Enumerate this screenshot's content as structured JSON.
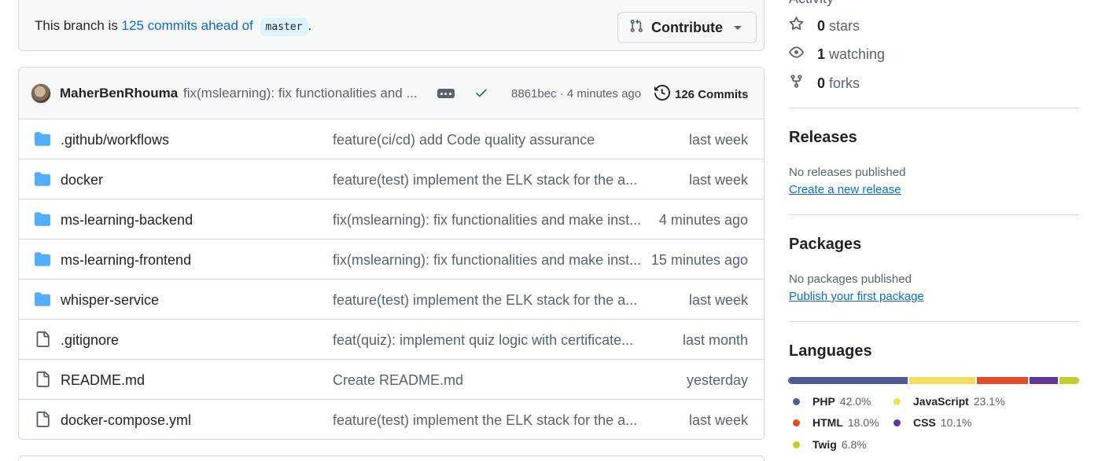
{
  "branch": {
    "prefix": "This branch is ",
    "ahead_link": "125 commits ahead of",
    "base_branch": "master",
    "suffix": ".",
    "contribute_label": "Contribute"
  },
  "commit": {
    "author": "MaherBenRhouma",
    "message": "fix(mslearning): fix functionalities and ...",
    "hash_time": "8861bec · 4 minutes ago",
    "commits_label": "126 Commits"
  },
  "files": [
    {
      "name": ".github/workflows",
      "type": "folder",
      "message": "feature(ci/cd) add Code quality assurance",
      "time": "last week"
    },
    {
      "name": "docker",
      "type": "folder",
      "message": "feature(test) implement the ELK stack for the a...",
      "time": "last week"
    },
    {
      "name": "ms-learning-backend",
      "type": "folder",
      "message": "fix(mslearning): fix functionalities and make inst...",
      "time": "4 minutes ago"
    },
    {
      "name": "ms-learning-frontend",
      "type": "folder",
      "message": "fix(mslearning): fix functionalities and make inst...",
      "time": "15 minutes ago"
    },
    {
      "name": "whisper-service",
      "type": "folder",
      "message": "feature(test) implement the ELK stack for the a...",
      "time": "last week"
    },
    {
      "name": ".gitignore",
      "type": "file",
      "message": "feat(quiz): implement quiz logic with certificate...",
      "time": "last month"
    },
    {
      "name": "README.md",
      "type": "file",
      "message": "Create README.md",
      "time": "yesterday"
    },
    {
      "name": "docker-compose.yml",
      "type": "file",
      "message": "feature(test) implement the ELK stack for the a...",
      "time": "last week"
    }
  ],
  "sidebar": {
    "activity": "Activity",
    "stars_count": "0",
    "stars_label": "stars",
    "watching_count": "1",
    "watching_label": "watching",
    "forks_count": "0",
    "forks_label": "forks",
    "releases_title": "Releases",
    "releases_note": "No releases published",
    "releases_link": "Create a new release",
    "packages_title": "Packages",
    "packages_note": "No packages published",
    "packages_link": "Publish your first package",
    "languages_title": "Languages"
  },
  "languages": [
    {
      "name": "PHP",
      "percent": "42.0%",
      "value": 42.0,
      "color": "#4F5D95"
    },
    {
      "name": "JavaScript",
      "percent": "23.1%",
      "value": 23.1,
      "color": "#f1e05a"
    },
    {
      "name": "HTML",
      "percent": "18.0%",
      "value": 18.0,
      "color": "#e34c26"
    },
    {
      "name": "CSS",
      "percent": "10.1%",
      "value": 10.1,
      "color": "#663399"
    },
    {
      "name": "Twig",
      "percent": "6.8%",
      "value": 6.8,
      "color": "#c1d026"
    }
  ],
  "colors": {
    "link": "#0969da",
    "folder": "#54aeff",
    "check": "#1a7f37"
  }
}
